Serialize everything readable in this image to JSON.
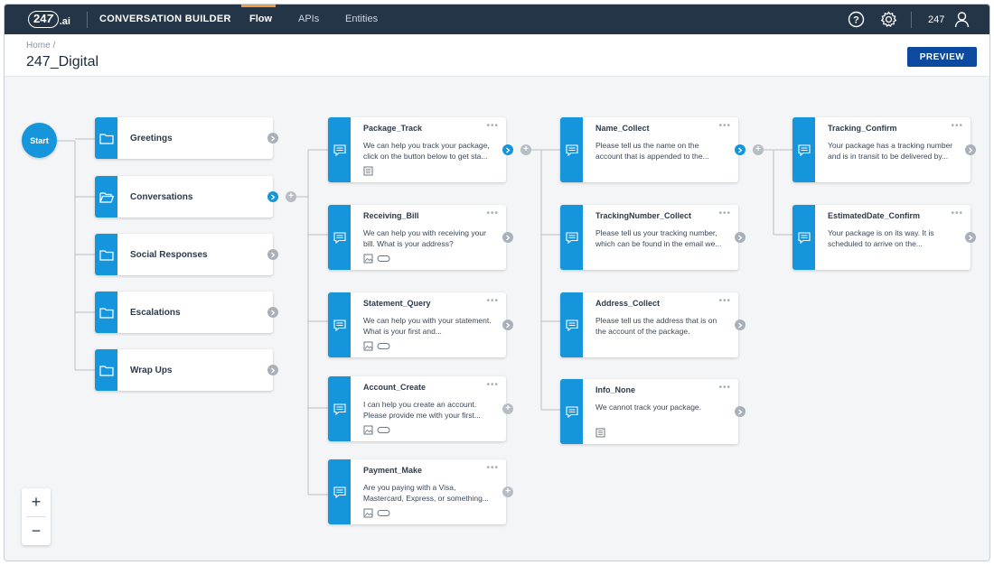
{
  "topbar": {
    "logo_badge": "24",
    "logo_seven": "7",
    "logo_suffix": ".ai",
    "app_title": "CONVERSATION BUILDER",
    "tabs": [
      {
        "label": "Flow",
        "active": true
      },
      {
        "label": "APIs",
        "active": false
      },
      {
        "label": "Entities",
        "active": false
      }
    ],
    "icons": [
      "help-icon",
      "gear-icon",
      "user-icon"
    ],
    "user_label": "247"
  },
  "header": {
    "breadcrumb": "Home /",
    "title": "247_Digital",
    "preview_label": "PREVIEW"
  },
  "colors": {
    "accent": "#1595dc",
    "topbar": "#243548",
    "tab_underline": "#f39c3c",
    "primary_button": "#0b4a9e"
  },
  "canvas": {
    "start_label": "Start",
    "folders": [
      {
        "label": "Greetings",
        "active": false
      },
      {
        "label": "Conversations",
        "active": true
      },
      {
        "label": "Social Responses",
        "active": false
      },
      {
        "label": "Escalations",
        "active": false
      },
      {
        "label": "Wrap Ups",
        "active": false
      }
    ],
    "column2": [
      {
        "name": "Package_Track",
        "desc": "We can help you track your package, click on the button below to get sta...",
        "attachments": [
          "table-icon"
        ],
        "action": "chevron-active"
      },
      {
        "name": "Receiving_Bill",
        "desc": "We can help you with receiving your bill. What is your address?",
        "attachments": [
          "image-icon",
          "link-icon"
        ],
        "action": "chevron"
      },
      {
        "name": "Statement_Query",
        "desc": "We can help you with your statement. What is your first and...",
        "attachments": [
          "image-icon",
          "link-icon"
        ],
        "action": "chevron"
      },
      {
        "name": "Account_Create",
        "desc": "I can help you create an account. Please provide me with your first...",
        "attachments": [
          "image-icon",
          "link-icon"
        ],
        "action": "plus"
      },
      {
        "name": "Payment_Make",
        "desc": "Are you paying with a Visa, Mastercard, Express, or something...",
        "attachments": [
          "image-icon",
          "link-icon"
        ],
        "action": "plus"
      }
    ],
    "column3": [
      {
        "name": "Name_Collect",
        "desc": "Please tell us the name on the account that is appended to the...",
        "attachments": [],
        "action": "chevron-active"
      },
      {
        "name": "TrackingNumber_Collect",
        "desc": "Please tell us your tracking number, which can be found in the email we...",
        "attachments": [],
        "action": "chevron"
      },
      {
        "name": "Address_Collect",
        "desc": "Please tell us the address that is on the account of the package.",
        "attachments": [],
        "action": "chevron"
      },
      {
        "name": "Info_None",
        "desc": "We cannot track your package.",
        "attachments": [
          "table-icon"
        ],
        "action": "chevron"
      }
    ],
    "column4": [
      {
        "name": "Tracking_Confirm",
        "desc": "Your package has a tracking number and is in transit to be delivered by...",
        "attachments": [],
        "action": "chevron"
      },
      {
        "name": "EstimatedDate_Confirm",
        "desc": "Your package is on its way. It is scheduled to arrive on the...",
        "attachments": [],
        "action": "chevron"
      }
    ],
    "more_label": "•••",
    "zoom_in": "+",
    "zoom_out": "−"
  }
}
